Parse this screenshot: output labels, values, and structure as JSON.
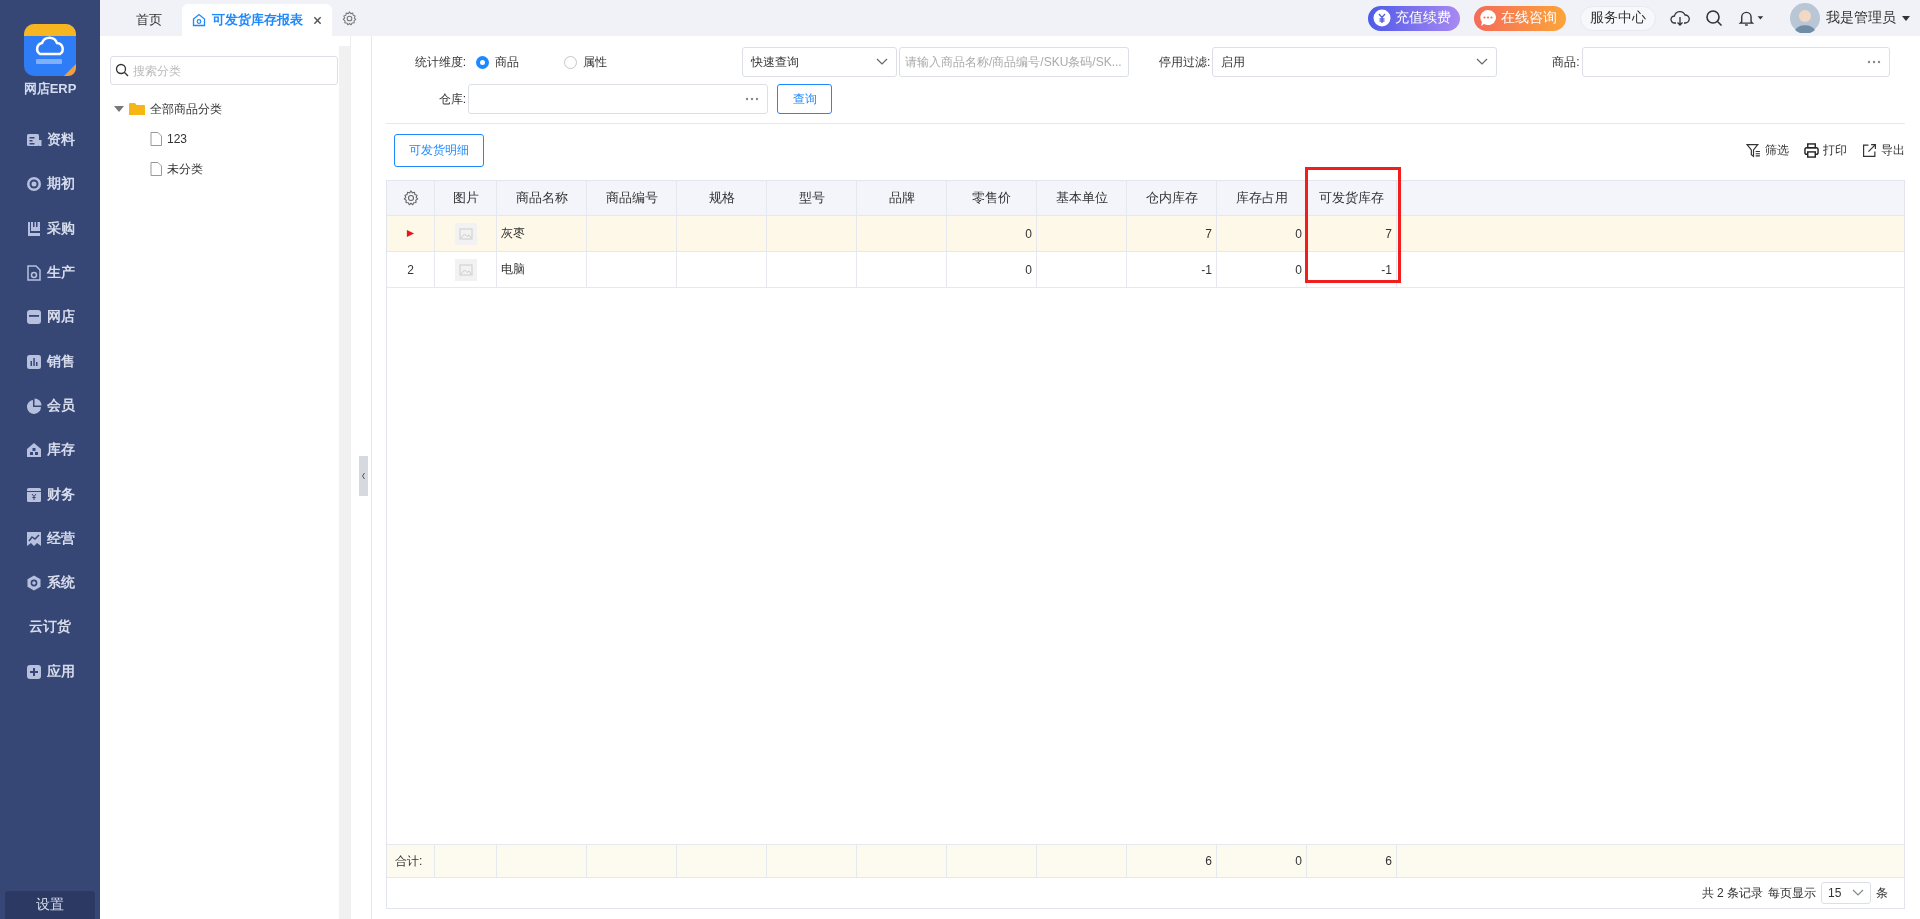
{
  "app": {
    "name": "网店ERP"
  },
  "nav": [
    {
      "label": "资料"
    },
    {
      "label": "期初"
    },
    {
      "label": "采购"
    },
    {
      "label": "生产"
    },
    {
      "label": "网店"
    },
    {
      "label": "销售"
    },
    {
      "label": "会员"
    },
    {
      "label": "库存"
    },
    {
      "label": "财务"
    },
    {
      "label": "经营"
    },
    {
      "label": "系统"
    },
    {
      "label": "云订货"
    },
    {
      "label": "应用"
    }
  ],
  "settings_button": "设置",
  "tabs": [
    {
      "label": "首页",
      "selected": false,
      "closable": false
    },
    {
      "label": "可发货库存报表",
      "selected": true,
      "closable": true
    }
  ],
  "top_actions": {
    "recharge": "充值续费",
    "consult": "在线咨询",
    "service": "服务中心",
    "user": "我是管理员"
  },
  "category_panel": {
    "search_placeholder": "搜索分类",
    "tree": [
      {
        "label": "全部商品分类",
        "expanded": true,
        "children": [
          {
            "label": "123"
          },
          {
            "label": "未分类"
          }
        ]
      }
    ]
  },
  "filters": {
    "dimension_label": "统计维度:",
    "dimension_options": [
      {
        "label": "商品",
        "selected": true
      },
      {
        "label": "属性",
        "selected": false
      }
    ],
    "quick_query": "快速查询",
    "keyword_placeholder": "请输入商品名称/商品编号/SKU条码/SK...",
    "disabled_filter_label": "停用过滤:",
    "disabled_filter_value": "启用",
    "product_label": "商品:",
    "warehouse_label": "仓库:",
    "query_button": "查询"
  },
  "detail_button": "可发货明细",
  "toolbar": [
    {
      "label": "筛选"
    },
    {
      "label": "打印"
    },
    {
      "label": "导出"
    }
  ],
  "table": {
    "columns": [
      {
        "label": "图片",
        "highlighted": false
      },
      {
        "label": "商品名称",
        "highlighted": false
      },
      {
        "label": "商品编号",
        "highlighted": false
      },
      {
        "label": "规格",
        "highlighted": false
      },
      {
        "label": "型号",
        "highlighted": false
      },
      {
        "label": "品牌",
        "highlighted": false
      },
      {
        "label": "零售价",
        "highlighted": false
      },
      {
        "label": "基本单位",
        "highlighted": false
      },
      {
        "label": "仓内库存",
        "highlighted": false
      },
      {
        "label": "库存占用",
        "highlighted": false
      },
      {
        "label": "可发货库存",
        "highlighted": true
      }
    ],
    "rows": [
      {
        "selected": true,
        "cells": {
          "name": "灰枣",
          "price": "0",
          "stock": "7",
          "occupied": "0",
          "available": "7"
        }
      },
      {
        "selected": false,
        "number": "2",
        "cells": {
          "name": "电脑",
          "price": "0",
          "stock": "-1",
          "occupied": "0",
          "available": "-1"
        }
      }
    ],
    "totals": {
      "label": "合计:",
      "cells": {
        "stock": "6",
        "occupied": "0",
        "available": "6"
      }
    }
  },
  "pagination": {
    "summary": "共 2 条记录",
    "per_page_label": "每页显示",
    "per_page": "15",
    "unit": "条"
  }
}
